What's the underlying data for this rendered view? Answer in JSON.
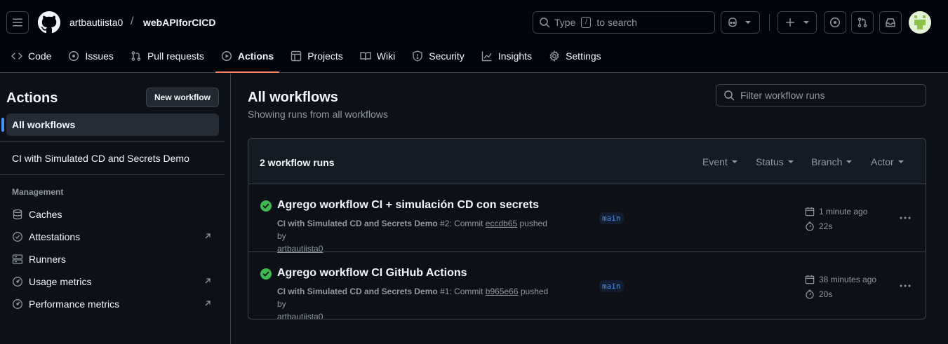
{
  "colors": {
    "background": "#0d1117",
    "header_bg": "#010409",
    "accent_tab": "#f78166",
    "link": "#4493f8",
    "success": "#3fb950"
  },
  "header": {
    "owner": "artbautiista0",
    "separator": "/",
    "repo": "webAPIforCICD",
    "search_prefix": "Type",
    "search_key": "/",
    "search_suffix": "to search",
    "icons": [
      "menu-icon",
      "github-logo-icon",
      "search-icon",
      "copilot-icon",
      "plus-icon",
      "issue-icon",
      "pull-request-icon",
      "inbox-icon"
    ]
  },
  "tabs": [
    {
      "label": "Code",
      "icon": "code-icon"
    },
    {
      "label": "Issues",
      "icon": "issue-icon"
    },
    {
      "label": "Pull requests",
      "icon": "pull-request-icon"
    },
    {
      "label": "Actions",
      "icon": "play-icon",
      "selected": true
    },
    {
      "label": "Projects",
      "icon": "table-icon"
    },
    {
      "label": "Wiki",
      "icon": "book-icon"
    },
    {
      "label": "Security",
      "icon": "shield-icon"
    },
    {
      "label": "Insights",
      "icon": "graph-icon"
    },
    {
      "label": "Settings",
      "icon": "gear-icon"
    }
  ],
  "sidebar": {
    "title": "Actions",
    "new_workflow": "New workflow",
    "all_workflows": "All workflows",
    "workflow": "CI with Simulated CD and Secrets Demo",
    "management_heading": "Management",
    "management": [
      {
        "label": "Caches",
        "icon": "database-icon",
        "external": false
      },
      {
        "label": "Attestations",
        "icon": "verified-icon",
        "external": true
      },
      {
        "label": "Runners",
        "icon": "server-icon",
        "external": false
      },
      {
        "label": "Usage metrics",
        "icon": "meter-icon",
        "external": true
      },
      {
        "label": "Performance metrics",
        "icon": "meter-icon",
        "external": true
      }
    ]
  },
  "main": {
    "title": "All workflows",
    "subtitle": "Showing runs from all workflows",
    "filter_placeholder": "Filter workflow runs",
    "runs_count": "2 workflow runs",
    "filters": [
      "Event",
      "Status",
      "Branch",
      "Actor"
    ],
    "runs": [
      {
        "title": "Agrego workflow CI + simulación CD con secrets",
        "workflow": "CI with Simulated CD and Secrets Demo",
        "run_number": "#2",
        "commit_label": "Commit",
        "commit": "eccdb65",
        "pushed_by": "pushed by",
        "actor": "artbautiista0",
        "branch": "main",
        "time": "1 minute ago",
        "duration": "22s",
        "status": "success"
      },
      {
        "title": "Agrego workflow CI GitHub Actions",
        "workflow": "CI with Simulated CD and Secrets Demo",
        "run_number": "#1",
        "commit_label": "Commit",
        "commit": "b965e66",
        "pushed_by": "pushed by",
        "actor": "artbautiista0",
        "branch": "main",
        "time": "38 minutes ago",
        "duration": "20s",
        "status": "success"
      }
    ]
  }
}
